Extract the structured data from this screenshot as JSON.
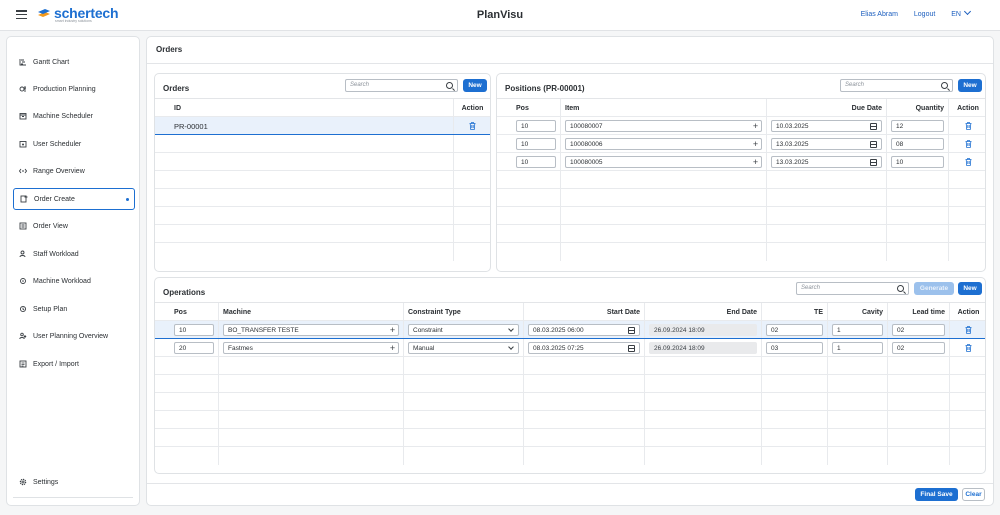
{
  "header": {
    "app_title": "PlanVisu",
    "logo_text": "schertech",
    "logo_tagline": "smart industry solutions",
    "user_name": "Elias Abram",
    "logout_label": "Logout",
    "language": "EN"
  },
  "sidebar": {
    "items": [
      {
        "label": "Gantt Chart",
        "icon": "gantt-icon"
      },
      {
        "label": "Production Planning",
        "icon": "production-icon"
      },
      {
        "label": "Machine Scheduler",
        "icon": "calendar-icon"
      },
      {
        "label": "User Scheduler",
        "icon": "user-calendar-icon"
      },
      {
        "label": "Range Overview",
        "icon": "range-icon"
      },
      {
        "label": "Order Create",
        "icon": "order-create-icon",
        "active": true
      },
      {
        "label": "Order View",
        "icon": "order-view-icon"
      },
      {
        "label": "Staff Workload",
        "icon": "staff-icon"
      },
      {
        "label": "Machine Workload",
        "icon": "machine-icon"
      },
      {
        "label": "Setup Plan",
        "icon": "setup-icon"
      },
      {
        "label": "User Planning Overview",
        "icon": "user-planning-icon"
      },
      {
        "label": "Export / Import",
        "icon": "export-import-icon"
      }
    ],
    "settings_label": "Settings"
  },
  "main": {
    "title": "Orders",
    "final_save_label": "Final Save",
    "clear_label": "Clear"
  },
  "orders": {
    "title": "Orders",
    "search_placeholder": "Search",
    "new_label": "New",
    "columns": {
      "id": "ID",
      "action": "Action"
    },
    "rows": [
      {
        "id": "PR-00001"
      }
    ]
  },
  "positions": {
    "title": "Positions (PR-00001)",
    "search_placeholder": "Search",
    "new_label": "New",
    "columns": {
      "pos": "Pos",
      "item": "Item",
      "due_date": "Due Date",
      "quantity": "Quantity",
      "action": "Action"
    },
    "rows": [
      {
        "pos": "10",
        "item": "100080007",
        "due_date": "10.03.2025",
        "quantity": "12"
      },
      {
        "pos": "10",
        "item": "100080006",
        "due_date": "13.03.2025",
        "quantity": "08"
      },
      {
        "pos": "10",
        "item": "100080005",
        "due_date": "13.03.2025",
        "quantity": "10"
      }
    ]
  },
  "operations": {
    "title": "Operations",
    "search_placeholder": "Search",
    "generate_label": "Generate",
    "new_label": "New",
    "columns": {
      "pos": "Pos",
      "machine": "Machine",
      "constraint_type": "Constraint Type",
      "start_date": "Start Date",
      "end_date": "End Date",
      "te": "TE",
      "cavity": "Cavity",
      "lead_time": "Lead time",
      "action": "Action"
    },
    "rows": [
      {
        "pos": "10",
        "machine": "BO_TRANSFER TESTE",
        "constraint_type": "Constraint",
        "start_date": "08.03.2025 06:00",
        "end_date": "26.09.2024 18:09",
        "te": "02",
        "cavity": "1",
        "lead_time": "02"
      },
      {
        "pos": "20",
        "machine": "Fastmes",
        "constraint_type": "Manual",
        "start_date": "08.03.2025 07:25",
        "end_date": "26.09.2024 18:09",
        "te": "03",
        "cavity": "1",
        "lead_time": "02"
      }
    ]
  },
  "colors": {
    "accent": "#1d6fd1",
    "selected_row": "#e9f1fb"
  }
}
